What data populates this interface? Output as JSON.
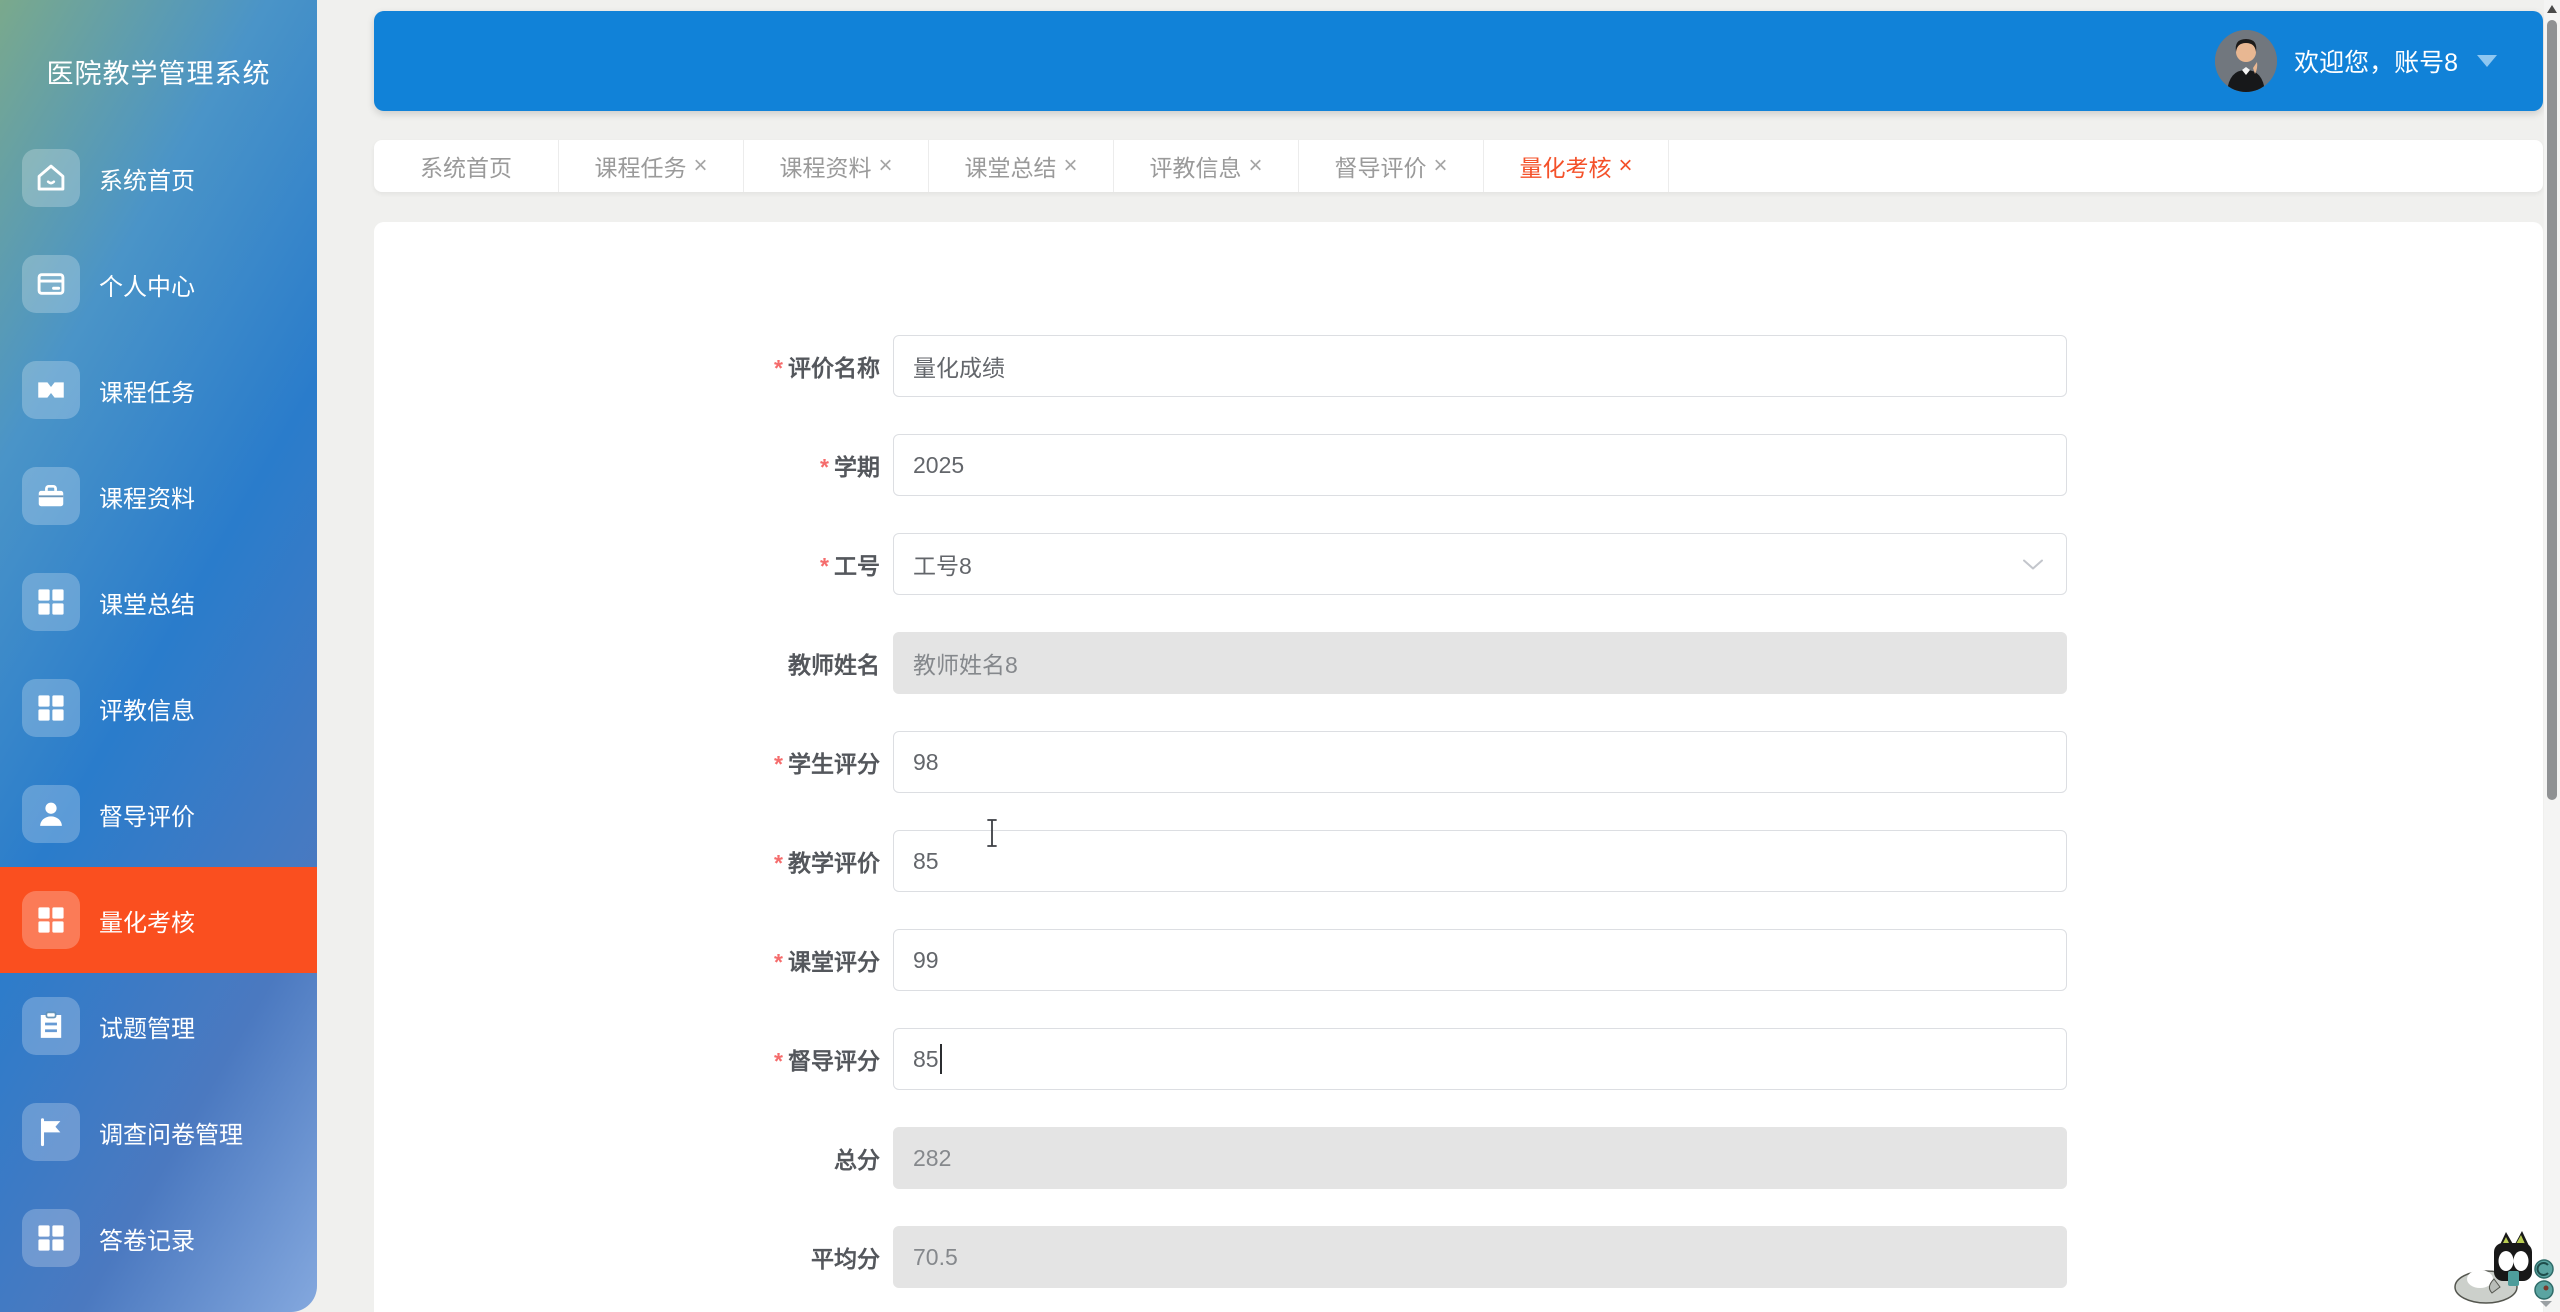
{
  "app": {
    "name": "医院教学管理系统"
  },
  "header": {
    "welcome_text": "欢迎您，账号8",
    "avatar_icon": "user-avatar",
    "caret_icon": "caret-down-icon",
    "background_color": "#1182d8"
  },
  "sidebar": {
    "title": "医院教学管理系统",
    "active_color": "#fa4f1f",
    "items": [
      {
        "label": "系统首页",
        "icon": "home-icon",
        "active": false
      },
      {
        "label": "个人中心",
        "icon": "profile-card-icon",
        "active": false
      },
      {
        "label": "课程任务",
        "icon": "ticket-icon",
        "active": false
      },
      {
        "label": "课程资料",
        "icon": "briefcase-icon",
        "active": false
      },
      {
        "label": "课堂总结",
        "icon": "grid-icon",
        "active": false
      },
      {
        "label": "评教信息",
        "icon": "grid-icon",
        "active": false
      },
      {
        "label": "督导评价",
        "icon": "user-icon",
        "active": false
      },
      {
        "label": "量化考核",
        "icon": "grid-icon",
        "active": true
      },
      {
        "label": "试题管理",
        "icon": "clipboard-icon",
        "active": false
      },
      {
        "label": "调查问卷管理",
        "icon": "flag-icon",
        "active": false
      },
      {
        "label": "答卷记录",
        "icon": "grid-icon",
        "active": false
      }
    ]
  },
  "tabs": {
    "close_glyph": "×",
    "active_color": "#f4512a",
    "items": [
      {
        "label": "系统首页",
        "closable": false,
        "active": false
      },
      {
        "label": "课程任务",
        "closable": true,
        "active": false
      },
      {
        "label": "课程资料",
        "closable": true,
        "active": false
      },
      {
        "label": "课堂总结",
        "closable": true,
        "active": false
      },
      {
        "label": "评教信息",
        "closable": true,
        "active": false
      },
      {
        "label": "督导评价",
        "closable": true,
        "active": false
      },
      {
        "label": "量化考核",
        "closable": true,
        "active": true
      }
    ]
  },
  "form": {
    "required_marker": "*",
    "fields": [
      {
        "label": "评价名称",
        "value": "量化成绩",
        "required": true,
        "type": "text"
      },
      {
        "label": "学期",
        "value": "2025",
        "required": true,
        "type": "text"
      },
      {
        "label": "工号",
        "value": "工号8",
        "required": true,
        "type": "select"
      },
      {
        "label": "教师姓名",
        "value": "教师姓名8",
        "required": false,
        "type": "text",
        "disabled": true
      },
      {
        "label": "学生评分",
        "value": "98",
        "required": true,
        "type": "text"
      },
      {
        "label": "教学评价",
        "value": "85",
        "required": true,
        "type": "text"
      },
      {
        "label": "课堂评分",
        "value": "99",
        "required": true,
        "type": "text"
      },
      {
        "label": "督导评分",
        "value": "85",
        "required": true,
        "type": "text",
        "focused": true
      },
      {
        "label": "总分",
        "value": "282",
        "required": false,
        "type": "text",
        "disabled": true
      },
      {
        "label": "平均分",
        "value": "70.5",
        "required": false,
        "type": "text",
        "disabled": true
      }
    ]
  },
  "colors": {
    "page_background": "#f0f0ee",
    "required_red": "#f56c6c",
    "input_border": "#dcdee2",
    "disabled_background": "#e4e4e4"
  }
}
